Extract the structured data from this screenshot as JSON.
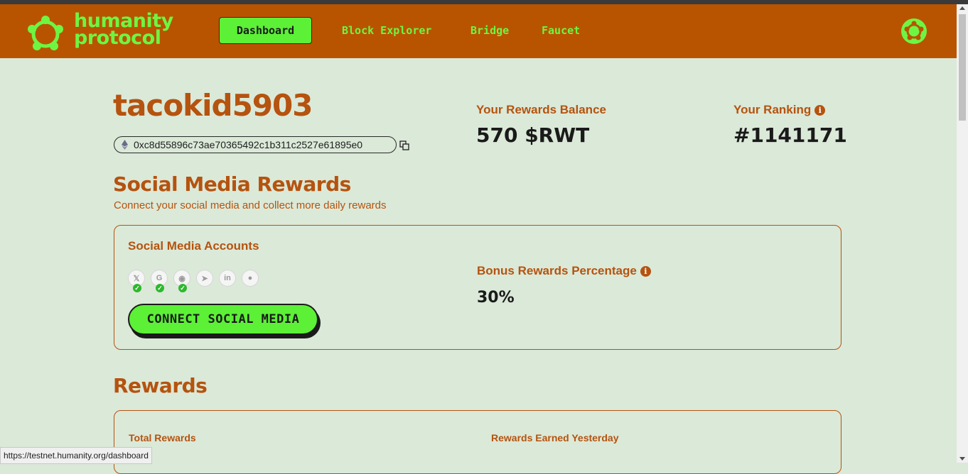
{
  "brand": {
    "name_line1": "humanity",
    "name_line2": "protocol"
  },
  "nav": {
    "dashboard": "Dashboard",
    "block_explorer": "Block Explorer",
    "bridge": "Bridge",
    "faucet": "Faucet"
  },
  "profile": {
    "username": "tacokid5903",
    "wallet_address": "0xc8d55896c73ae70365492c1b311c2527e61895e0"
  },
  "stats": {
    "balance_label": "Your Rewards Balance",
    "balance_value": "570 $RWT",
    "ranking_label": "Your Ranking",
    "ranking_value": "#1141171"
  },
  "social_section": {
    "title": "Social Media Rewards",
    "subtitle": "Connect your social media and collect more daily rewards",
    "accounts_label": "Social Media Accounts",
    "accounts": [
      {
        "name": "X",
        "icon": "x-icon",
        "glyph": "𝕏",
        "connected": true
      },
      {
        "name": "Google",
        "icon": "google-icon",
        "glyph": "G",
        "connected": true
      },
      {
        "name": "Discord",
        "icon": "discord-icon",
        "glyph": "◉",
        "connected": true
      },
      {
        "name": "Telegram",
        "icon": "telegram-icon",
        "glyph": "➤",
        "connected": false
      },
      {
        "name": "LinkedIn",
        "icon": "linkedin-icon",
        "glyph": "in",
        "connected": false
      },
      {
        "name": "GitHub",
        "icon": "github-icon",
        "glyph": "●",
        "connected": false
      }
    ],
    "connect_button": "CONNECT SOCIAL MEDIA",
    "bonus_label": "Bonus Rewards Percentage",
    "bonus_value": "30%"
  },
  "rewards_section": {
    "title": "Rewards",
    "total_label": "Total Rewards",
    "yesterday_label": "Rewards Earned Yesterday"
  },
  "status_bar": {
    "url": "https://testnet.humanity.org/dashboard"
  },
  "colors": {
    "header": "#b85400",
    "accent_green": "#5cf037",
    "brand_orange": "#b5530f",
    "page_bg": "#dbe9d8"
  }
}
